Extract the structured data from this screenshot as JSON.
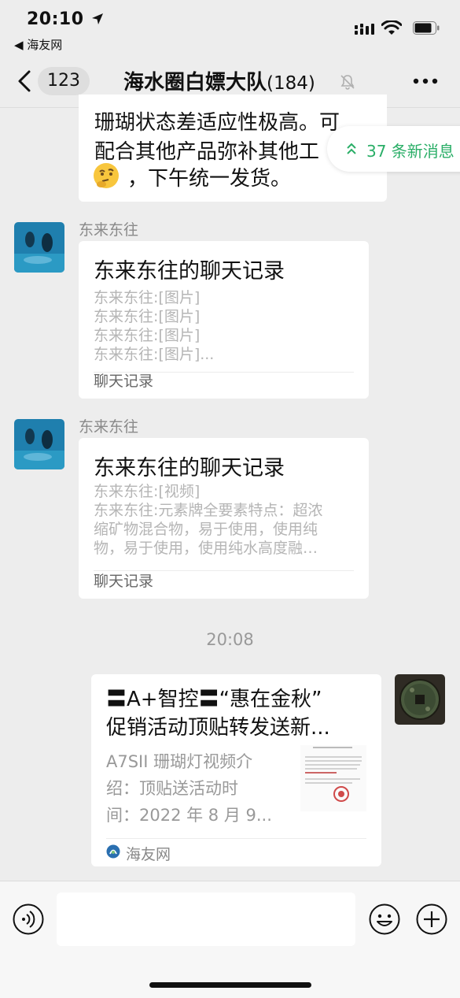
{
  "status": {
    "time": "20:10",
    "back_app": "◀ 海友网"
  },
  "nav": {
    "unread_count": "123",
    "title": "海水圈白嫖大队",
    "member_count": "(184)"
  },
  "new_messages": {
    "label": "37 条新消息"
  },
  "partial_message": {
    "line1": "珊瑚状态差适应性极高。可",
    "line2": "配合其他产品弥补其他工",
    "line3": "，下午统一发货。"
  },
  "messages": [
    {
      "sender": "东来东往",
      "title": "东来东往的聊天记录",
      "lines": [
        "东来东往:[图片]",
        "东来东往:[图片]",
        "东来东往:[图片]",
        "东来东往:[图片]..."
      ],
      "footer": "聊天记录"
    },
    {
      "sender": "东来东往",
      "title": "东来东往的聊天记录",
      "lines": [
        "东来东往:[视频]",
        "东来东往:元素牌全要素特点：超浓",
        "缩矿物混合物，易于使用，使用纯",
        "物，易于使用，使用纯水高度融…"
      ],
      "footer": "聊天记录"
    }
  ],
  "timestamp": "20:08",
  "link_card": {
    "title_line1": "〓A+智控〓“惠在金秋”",
    "title_line2": "促销活动顶贴转发送新...",
    "desc_line1": "A7SII 珊瑚灯视频介",
    "desc_line2": "绍：顶贴送活动时",
    "desc_line3": "间：2022 年 8 月 9...",
    "source": "海友网"
  },
  "colors": {
    "accent_green": "#2aae67",
    "background": "#ededed"
  }
}
